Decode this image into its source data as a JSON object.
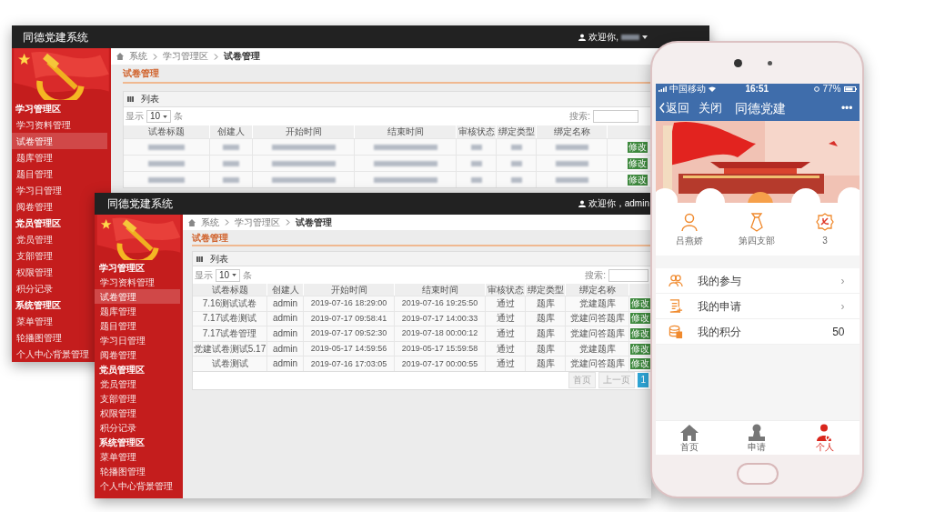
{
  "back_window": {
    "title": "同德党建系统",
    "user_greeting": "欢迎你,",
    "breadcrumb": [
      "系统",
      "学习管理区",
      "试卷管理"
    ],
    "page_title": "试卷管理",
    "panel_title": "列表",
    "length": {
      "prefix": "显示",
      "value": "10",
      "suffix": "条"
    },
    "search_label": "搜索:",
    "columns": [
      "试卷标题",
      "创建人",
      "开始时间",
      "结束时间",
      "审核状态",
      "绑定类型",
      "绑定名称"
    ],
    "rows": [
      {
        "action": "修改"
      },
      {
        "action": "修改"
      },
      {
        "action": "修改"
      }
    ],
    "sidebar": [
      {
        "title": "学习管理区",
        "items": [
          {
            "label": "学习资料管理",
            "selected": false
          },
          {
            "label": "试卷管理",
            "selected": true
          },
          {
            "label": "题库管理",
            "selected": false
          },
          {
            "label": "题目管理",
            "selected": false
          },
          {
            "label": "学习日管理",
            "selected": false
          },
          {
            "label": "阅卷管理",
            "selected": false
          }
        ]
      },
      {
        "title": "党员管理区",
        "items": [
          {
            "label": "党员管理",
            "selected": false
          },
          {
            "label": "支部管理",
            "selected": false
          },
          {
            "label": "权限管理",
            "selected": false
          },
          {
            "label": "积分记录",
            "selected": false
          }
        ]
      },
      {
        "title": "系统管理区",
        "items": [
          {
            "label": "菜单管理",
            "selected": false
          },
          {
            "label": "轮播图管理",
            "selected": false
          },
          {
            "label": "个人中心背景管理",
            "selected": false
          }
        ]
      }
    ]
  },
  "front_window": {
    "title": "同德党建系统",
    "user_greeting": "欢迎你，admin",
    "breadcrumb": [
      "系统",
      "学习管理区",
      "试卷管理"
    ],
    "page_title": "试卷管理",
    "panel_title": "列表",
    "length": {
      "prefix": "显示",
      "value": "10",
      "suffix": "条"
    },
    "search_label": "搜索:",
    "columns": [
      "试卷标题",
      "创建人",
      "开始时间",
      "结束时间",
      "审核状态",
      "绑定类型",
      "绑定名称"
    ],
    "rows": [
      {
        "cells": [
          "7.16测试试卷",
          "admin",
          "2019-07-16 18:29:00",
          "2019-07-16 19:25:50",
          "通过",
          "题库",
          "党建题库"
        ],
        "action": "修改"
      },
      {
        "cells": [
          "7.17试卷测试",
          "admin",
          "2019-07-17 09:58:41",
          "2019-07-17 14:00:33",
          "通过",
          "题库",
          "党建问答题库"
        ],
        "action": "修改"
      },
      {
        "cells": [
          "7.17试卷管理",
          "admin",
          "2019-07-17 09:52:30",
          "2019-07-18 00:00:12",
          "通过",
          "题库",
          "党建问答题库"
        ],
        "action": "修改"
      },
      {
        "cells": [
          "党建试卷测试5.17",
          "admin",
          "2019-05-17 14:59:56",
          "2019-05-17 15:59:58",
          "通过",
          "题库",
          "党建题库"
        ],
        "action": "修改"
      },
      {
        "cells": [
          "试卷测试",
          "admin",
          "2019-07-16 17:03:05",
          "2019-07-17 00:00:55",
          "通过",
          "题库",
          "党建问答题库"
        ],
        "action": "修改"
      }
    ],
    "pagination": [
      {
        "label": "首页",
        "selected": false
      },
      {
        "label": "上一页",
        "selected": false
      },
      {
        "label": "1",
        "selected": true
      }
    ],
    "sidebar": [
      {
        "title": "学习管理区",
        "items": [
          {
            "label": "学习资料管理",
            "selected": false
          },
          {
            "label": "试卷管理",
            "selected": true
          },
          {
            "label": "题库管理",
            "selected": false
          },
          {
            "label": "题目管理",
            "selected": false
          },
          {
            "label": "学习日管理",
            "selected": false
          },
          {
            "label": "阅卷管理",
            "selected": false
          }
        ]
      },
      {
        "title": "党员管理区",
        "items": [
          {
            "label": "党员管理",
            "selected": false
          },
          {
            "label": "支部管理",
            "selected": false
          },
          {
            "label": "权限管理",
            "selected": false
          },
          {
            "label": "积分记录",
            "selected": false
          }
        ]
      },
      {
        "title": "系统管理区",
        "items": [
          {
            "label": "菜单管理",
            "selected": false
          },
          {
            "label": "轮播图管理",
            "selected": false
          },
          {
            "label": "个人中心背景管理",
            "selected": false
          }
        ]
      }
    ]
  },
  "phone": {
    "status_bar": {
      "carrier": "中国移动",
      "time": "16:51",
      "battery": "77%"
    },
    "nav": {
      "back": "返回",
      "close": "关闭",
      "title": "同德党建",
      "more": "•••"
    },
    "profile": [
      {
        "kind": "person",
        "label": "吕燕娇"
      },
      {
        "kind": "branch",
        "label": "第四支部"
      },
      {
        "kind": "badge",
        "label": "3"
      }
    ],
    "menu": [
      {
        "kind": "participation",
        "label": "我的参与",
        "chevron": "›"
      },
      {
        "kind": "application",
        "label": "我的申请",
        "chevron": "›"
      },
      {
        "kind": "points",
        "label": "我的积分",
        "value": "50"
      }
    ],
    "tabs": [
      {
        "kind": "home",
        "label": "首页",
        "selected": false
      },
      {
        "kind": "apply",
        "label": "申请",
        "selected": false
      },
      {
        "kind": "personal",
        "label": "个人",
        "selected": true
      }
    ]
  }
}
